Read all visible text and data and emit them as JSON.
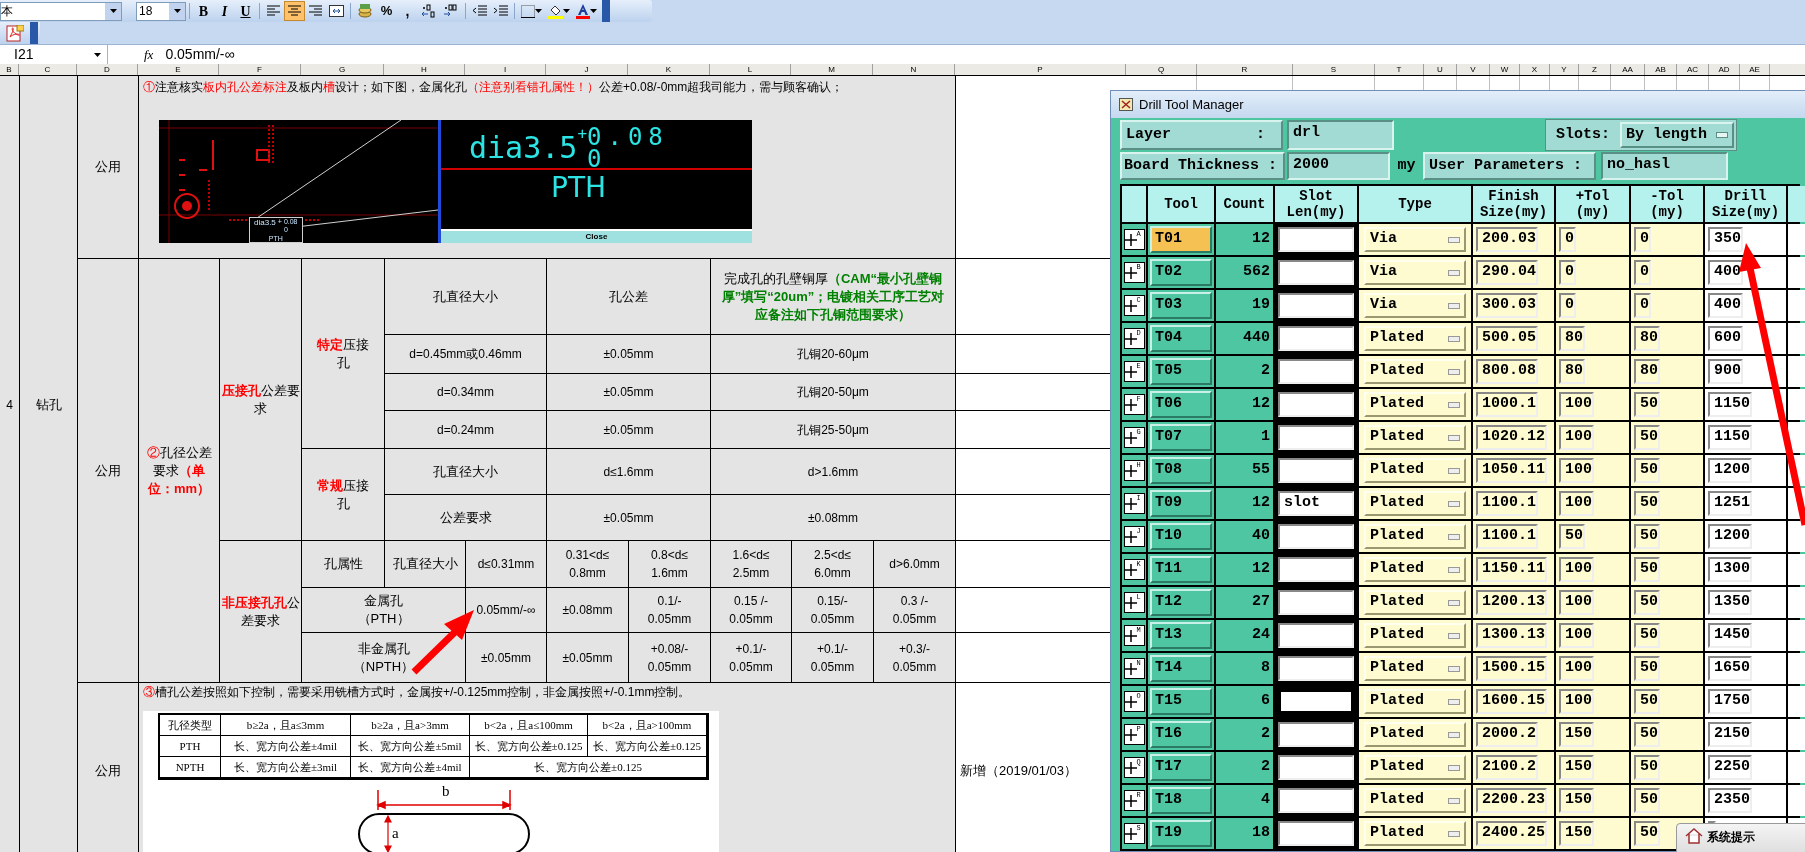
{
  "toolbar": {
    "font": "本",
    "size": "18",
    "bold": "B",
    "italic": "I",
    "underline": "U",
    "percent": "%",
    "comma": ",",
    "alignment": [
      {
        "selected": false
      },
      {
        "selected": true
      },
      {
        "selected": false
      }
    ]
  },
  "formula_bar": {
    "cell": "I21",
    "function_label": "fx",
    "value": "0.05mm/-∞"
  },
  "columns": [
    "B",
    "C",
    "D",
    "E",
    "F",
    "G",
    "H",
    "I",
    "J",
    "K",
    "L",
    "M",
    "N",
    "P",
    "Q",
    "R",
    "S",
    "T",
    "U",
    "V",
    "W",
    "X",
    "Y",
    "Z",
    "AA",
    "AB",
    "AC",
    "AD",
    "AE"
  ],
  "sheet": {
    "row_label": "4",
    "item": "钻孔",
    "notice": {
      "scope": "公用",
      "text": [
        {
          "kind": "alert",
          "text": "①"
        },
        {
          "kind": "plain",
          "text": "注意核实"
        },
        {
          "kind": "alert",
          "text": "板内孔公差标注"
        },
        {
          "kind": "plain",
          "text": "及板内"
        },
        {
          "kind": "alert",
          "text": "槽"
        },
        {
          "kind": "plain",
          "text": "设计；如下图，金属化孔"
        },
        {
          "kind": "alert",
          "text": "（注意别看错孔属性！）"
        },
        {
          "kind": "plain",
          "text": "公差+0.08/-0mm超我司能力，需与顾客确认；"
        }
      ],
      "screenshot": {
        "callout": {
          "label": "dia3.5",
          "sign": "+",
          "upper": "0.08",
          "lower": "0",
          "type": "PTH"
        },
        "label": "dia3.5",
        "sign": "+",
        "upper": "0.08",
        "lower": "0",
        "type": "PTH",
        "button": "Close"
      }
    },
    "hole_tolerance": {
      "scope": "公用",
      "title": [
        {
          "kind": "alert",
          "text": "②"
        },
        {
          "kind": "plain",
          "text": "孔径公差要求"
        },
        {
          "kind": "strong",
          "text": "（单位：mm）"
        }
      ],
      "press_fit": {
        "title": [
          {
            "kind": "strong",
            "text": "压接孔"
          },
          {
            "kind": "plain",
            "text": "公差要求"
          }
        ],
        "special": {
          "title": [
            {
              "kind": "strong",
              "text": "特定"
            },
            {
              "kind": "plain",
              "text": "压接孔"
            }
          ],
          "header": [
            [
              {
                "kind": "plain",
                "text": "孔直径大小"
              }
            ],
            [
              {
                "kind": "plain",
                "text": "孔公差"
              }
            ],
            [
              {
                "kind": "plain",
                "text": "完成孔的孔壁铜厚"
              },
              {
                "kind": "remark",
                "text": "（CAM“最小孔壁铜厚”填写“20um”；电镀相关工序工艺对应备注如下孔铜范围要求）"
              }
            ]
          ],
          "rows": [
            [
              "d=0.45mm或0.46mm",
              "±0.05mm",
              "孔铜20-60μm"
            ],
            [
              "d=0.34mm",
              "±0.05mm",
              "孔铜20-50μm"
            ],
            [
              "d=0.24mm",
              "±0.05mm",
              "孔铜25-50μm"
            ]
          ]
        },
        "regular": {
          "title": [
            {
              "kind": "strong",
              "text": "常规"
            },
            {
              "kind": "plain",
              "text": "压接孔"
            }
          ],
          "rows": [
            [
              "孔直径大小",
              "d≤1.6mm",
              "d>1.6mm"
            ],
            [
              "公差要求",
              "±0.05mm",
              "±0.08mm"
            ]
          ]
        }
      },
      "non_press_fit": {
        "title": [
          {
            "kind": "strong",
            "text": "非压接孔孔"
          },
          {
            "kind": "plain",
            "text": "公差要求"
          }
        ],
        "attribute": "孔属性",
        "size_label": "孔直径大小",
        "ranges": [
          "d≤0.31mm",
          "0.31<d≤\n0.8mm",
          "0.8<d≤\n1.6mm",
          "1.6<d≤\n2.5mm",
          "2.5<d≤\n6.0mm",
          "d>6.0mm"
        ],
        "rows": [
          {
            "label": [
              "金属孔",
              "（PTH）"
            ],
            "values": [
              "0.05mm/-∞",
              "±0.08mm",
              "0.1/-\n0.05mm",
              "0.15 /-\n0.05mm",
              "0.15/-\n0.05mm",
              "0.3 /-\n0.05mm"
            ]
          },
          {
            "label": [
              "非金属孔",
              "（NPTH）"
            ],
            "values": [
              "±0.05mm",
              "±0.05mm",
              "+0.08/-\n0.05mm",
              "+0.1/-\n0.05mm",
              "+0.1/-\n0.05mm",
              "+0.3/-\n0.05mm"
            ]
          }
        ]
      }
    },
    "slot_tolerance": {
      "scope": "公用",
      "remark": "新增（2019/01/03）",
      "text": [
        {
          "kind": "alert",
          "text": "③"
        },
        {
          "kind": "plain",
          "text": "槽孔公差按照如下控制，需要采用铣槽方式时，金属按+/-0.125mm控制，非金属按照+/-0.1mm控制。"
        }
      ],
      "table": {
        "header": [
          "孔径类型",
          "b≥2a，且a≤3mm",
          "b≥2a，且a>3mm",
          "b<2a，且a≤100mm",
          "b<2a，且a>100mm"
        ],
        "rows": [
          [
            "PTH",
            "长、宽方向公差±4mil",
            "长、宽方向公差±5mil",
            "长、宽方向公差±0.125",
            "长、宽方向公差±0.125"
          ],
          [
            "NPTH",
            "长、宽方向公差±3mil",
            "长、宽方向公差±4mil",
            "长、宽方向公差±0.125"
          ]
        ]
      },
      "diagram": {
        "length": "b",
        "width": "a"
      }
    }
  },
  "dialog": {
    "title": "Drill Tool Manager",
    "layer_label": "Layer",
    "colon": ":",
    "layer": "drl",
    "slots_label": "Slots:",
    "slots": "By length",
    "thickness_label": "Board Thickness :",
    "thickness": "2000",
    "unit": "my",
    "params_label": "User Parameters :",
    "params": "no_hasl",
    "columns": [
      "Tool",
      "Count",
      "Slot\nLen(my)",
      "Type",
      "Finish\nSize(my)",
      "+Tol\n(my)",
      "-Tol\n(my)",
      "Drill\nSize(my)"
    ],
    "rows": [
      {
        "key": "A",
        "tool": "T01",
        "selected": true,
        "count": "12",
        "focused": false,
        "type": "Via",
        "finish": "200.03",
        "plus_tol": "0",
        "minus_tol": "0",
        "drill": "350"
      },
      {
        "key": "B",
        "tool": "T02",
        "selected": false,
        "count": "562",
        "focused": false,
        "type": "Via",
        "finish": "290.04",
        "plus_tol": "0",
        "minus_tol": "0",
        "drill": "400"
      },
      {
        "key": "C",
        "tool": "T03",
        "selected": false,
        "count": "19",
        "focused": false,
        "type": "Via",
        "finish": "300.03",
        "plus_tol": "0",
        "minus_tol": "0",
        "drill": "400"
      },
      {
        "key": "D",
        "tool": "T04",
        "selected": false,
        "count": "440",
        "focused": false,
        "type": "Plated",
        "finish": "500.05",
        "plus_tol": "80",
        "minus_tol": "80",
        "drill": "600"
      },
      {
        "key": "E",
        "tool": "T05",
        "selected": false,
        "count": "2",
        "focused": false,
        "type": "Plated",
        "finish": "800.08",
        "plus_tol": "80",
        "minus_tol": "80",
        "drill": "900"
      },
      {
        "key": "F",
        "tool": "T06",
        "selected": false,
        "count": "12",
        "focused": false,
        "type": "Plated",
        "finish": "1000.1",
        "plus_tol": "100",
        "minus_tol": "50",
        "drill": "1150"
      },
      {
        "key": "G",
        "tool": "T07",
        "selected": false,
        "count": "1",
        "focused": false,
        "type": "Plated",
        "finish": "1020.12",
        "plus_tol": "100",
        "minus_tol": "50",
        "drill": "1150"
      },
      {
        "key": "H",
        "tool": "T08",
        "selected": false,
        "count": "55",
        "focused": false,
        "type": "Plated",
        "finish": "1050.11",
        "plus_tol": "100",
        "minus_tol": "50",
        "drill": "1200"
      },
      {
        "key": "I",
        "tool": "T09",
        "selected": false,
        "count": "12",
        "slot_len": "slot",
        "focused": false,
        "type": "Plated",
        "finish": "1100.1",
        "plus_tol": "100",
        "minus_tol": "50",
        "drill": "1251"
      },
      {
        "key": "J",
        "tool": "T10",
        "selected": false,
        "count": "40",
        "focused": false,
        "type": "Plated",
        "finish": "1100.1",
        "plus_tol": "50",
        "minus_tol": "50",
        "drill": "1200"
      },
      {
        "key": "K",
        "tool": "T11",
        "selected": false,
        "count": "12",
        "focused": false,
        "type": "Plated",
        "finish": "1150.11",
        "plus_tol": "100",
        "minus_tol": "50",
        "drill": "1300"
      },
      {
        "key": "L",
        "tool": "T12",
        "selected": false,
        "count": "27",
        "focused": false,
        "type": "Plated",
        "finish": "1200.13",
        "plus_tol": "100",
        "minus_tol": "50",
        "drill": "1350"
      },
      {
        "key": "M",
        "tool": "T13",
        "selected": false,
        "count": "24",
        "focused": false,
        "type": "Plated",
        "finish": "1300.13",
        "plus_tol": "100",
        "minus_tol": "50",
        "drill": "1450"
      },
      {
        "key": "N",
        "tool": "T14",
        "selected": false,
        "count": "8",
        "focused": false,
        "type": "Plated",
        "finish": "1500.15",
        "plus_tol": "100",
        "minus_tol": "50",
        "drill": "1650"
      },
      {
        "key": "O",
        "tool": "T15",
        "selected": false,
        "count": "6",
        "focused": true,
        "type": "Plated",
        "finish": "1600.15",
        "plus_tol": "100",
        "minus_tol": "50",
        "drill": "1750"
      },
      {
        "key": "P",
        "tool": "T16",
        "selected": false,
        "count": "2",
        "focused": false,
        "type": "Plated",
        "finish": "2000.2",
        "plus_tol": "150",
        "minus_tol": "50",
        "drill": "2150"
      },
      {
        "key": "Q",
        "tool": "T17",
        "selected": false,
        "count": "2",
        "focused": false,
        "type": "Plated",
        "finish": "2100.2",
        "plus_tol": "150",
        "minus_tol": "50",
        "drill": "2250"
      },
      {
        "key": "R",
        "tool": "T18",
        "selected": false,
        "count": "4",
        "focused": false,
        "type": "Plated",
        "finish": "2200.23",
        "plus_tol": "150",
        "minus_tol": "50",
        "drill": "2350"
      },
      {
        "key": "S",
        "tool": "T19",
        "selected": false,
        "count": "18",
        "focused": false,
        "type": "Plated",
        "finish": "2400.25",
        "plus_tol": "150",
        "minus_tol": "50"
      }
    ]
  },
  "popup": {
    "title": "系统提示"
  }
}
